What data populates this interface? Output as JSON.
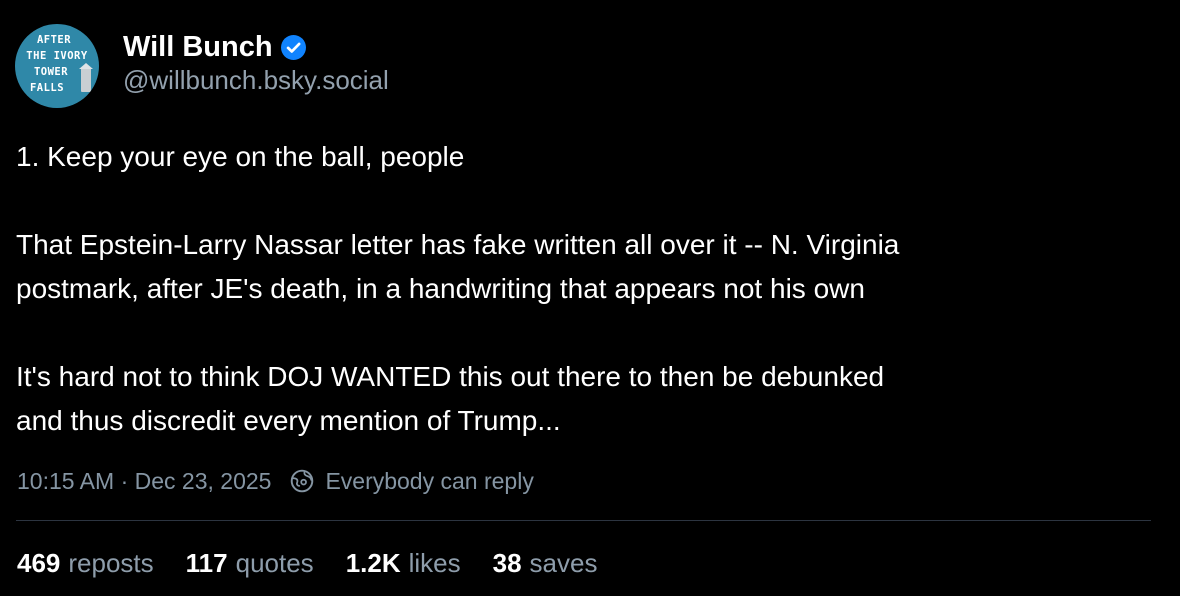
{
  "author": {
    "display_name": "Will Bunch",
    "handle": "@willbunch.bsky.social",
    "verified": true,
    "avatar_text": [
      "AFTER",
      "THE IVORY",
      "TOWER",
      "FALLS"
    ]
  },
  "post": {
    "paragraphs": [
      [
        "1. Keep your eye on the ball, people"
      ],
      [
        "That Epstein-Larry Nassar letter has fake written all over it -- N. Virginia",
        "postmark, after JE's death, in a handwriting that appears not his own"
      ],
      [
        "It's hard not to think DOJ WANTED this out there to then be debunked",
        "and thus discredit every mention of Trump..."
      ]
    ],
    "timestamp": "10:15 AM · Dec 23, 2025",
    "reply_setting": "Everybody can reply"
  },
  "stats": {
    "reposts": {
      "count": "469",
      "label": "reposts"
    },
    "quotes": {
      "count": "117",
      "label": "quotes"
    },
    "likes": {
      "count": "1.2K",
      "label": "likes"
    },
    "saves": {
      "count": "38",
      "label": "saves"
    }
  },
  "colors": {
    "background": "#000000",
    "text": "#ffffff",
    "muted": "#8e9dab",
    "verified_badge": "#1083fe",
    "avatar_bg": "#2f88a8",
    "divider": "#2c3440"
  },
  "icons": {
    "verified": "verified-check-icon",
    "reply_setting": "reply-globe-icon"
  }
}
